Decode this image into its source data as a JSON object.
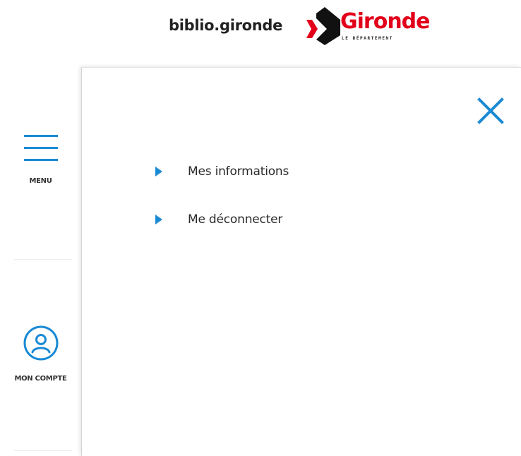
{
  "header": {
    "site_name": "biblio.gironde",
    "logo_name": "Gironde",
    "logo_subtitle": "LE DÉPARTEMENT"
  },
  "sidebar": {
    "menu_label": "MENU",
    "menu_icon": "hamburger-icon",
    "account_label": "MON COMPTE",
    "account_icon": "user-circle-icon"
  },
  "panel": {
    "close_icon": "close-icon",
    "items": [
      {
        "label": "Mes informations",
        "icon": "caret-right-icon"
      },
      {
        "label": "Me déconnecter",
        "icon": "caret-right-icon"
      }
    ]
  },
  "colors": {
    "accent": "#1a8ad4",
    "brand_red": "#e2001a",
    "logo_black": "#111111",
    "text": "#2b2b2b"
  }
}
